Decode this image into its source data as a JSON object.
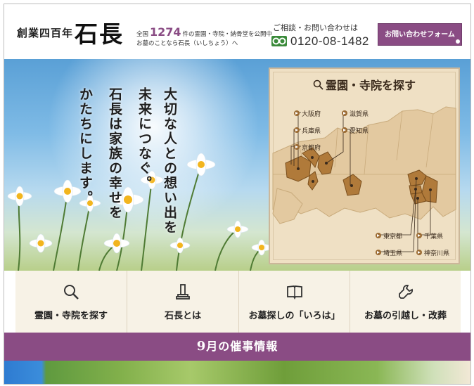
{
  "header": {
    "tagline": "創業四百年",
    "logo": "石長",
    "intro_prefix": "全国",
    "intro_count": "1274",
    "intro_suffix": "件の霊園・寺院・納骨堂を公開中",
    "intro_line2": "お墓のことなら石長（いしちょう）へ",
    "contact_label": "ご相談・お問い合わせは",
    "phone_icon": "free-dial-icon",
    "phone_number": "0120-08-1482",
    "inquiry_button": "お問い合わせフォーム"
  },
  "hero": {
    "copy_lines": [
      "大切な人との想い出を",
      "未来につなぐ。",
      "石長は家族の幸せを",
      "かたちにします。"
    ],
    "map": {
      "title": "霊園・寺院を探す",
      "search_icon": "search-icon",
      "prefectures": {
        "osaka": "大阪府",
        "hyogo": "兵庫県",
        "kyoto": "京都府",
        "shiga": "滋賀県",
        "aichi": "愛知県",
        "tokyo": "東京都",
        "saitama": "埼玉県",
        "chiba": "千葉県",
        "kanagawa": "神奈川県"
      }
    }
  },
  "nav": {
    "items": [
      {
        "label": "霊園・寺院を探す",
        "icon": "search-icon"
      },
      {
        "label": "石長とは",
        "icon": "gravestone-icon"
      },
      {
        "label": "お墓探しの「いろは」",
        "icon": "book-icon"
      },
      {
        "label": "お墓の引越し・改葬",
        "icon": "wrench-icon"
      }
    ]
  },
  "events": {
    "month": "9",
    "title_suffix": "月の催事情報"
  },
  "colors": {
    "accent_purple": "#8a4c84",
    "nav_background": "#f7f2e6",
    "map_background": "#efe0c4",
    "region_highlight": "#b07a3a"
  }
}
